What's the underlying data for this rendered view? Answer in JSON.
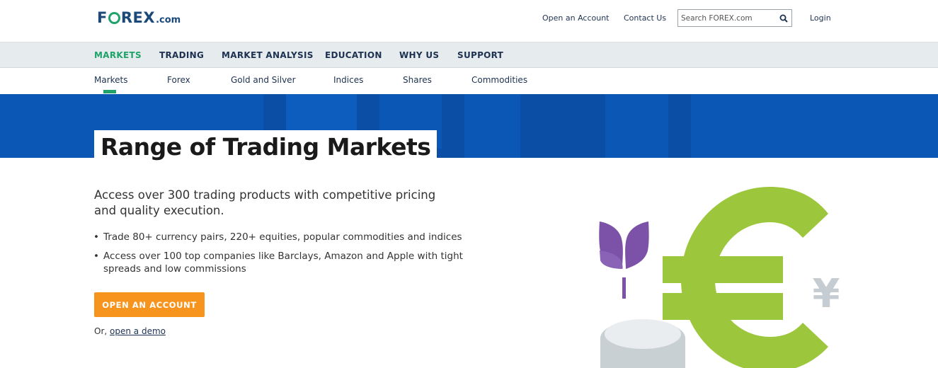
{
  "header": {
    "logo": {
      "left": "F",
      "right": "REX",
      "suffix": ".com"
    },
    "links": {
      "open_account": "Open an Account",
      "contact": "Contact Us",
      "login": "Login"
    },
    "search": {
      "placeholder": "Search FOREX.com"
    }
  },
  "main_nav": [
    {
      "label": "MARKETS",
      "active": true
    },
    {
      "label": "TRADING",
      "active": false
    },
    {
      "label": "MARKET ANALYSIS",
      "active": false
    },
    {
      "label": "EDUCATION",
      "active": false
    },
    {
      "label": "WHY US",
      "active": false
    },
    {
      "label": "SUPPORT",
      "active": false
    }
  ],
  "sub_nav": [
    {
      "label": "Markets",
      "active": true
    },
    {
      "label": "Forex",
      "active": false
    },
    {
      "label": "Gold and Silver",
      "active": false
    },
    {
      "label": "Indices",
      "active": false
    },
    {
      "label": "Shares",
      "active": false
    },
    {
      "label": "Commodities",
      "active": false
    }
  ],
  "hero": {
    "title": "Range of Trading Markets"
  },
  "content": {
    "intro": "Access over 300 trading products with competitive pricing and quality execution.",
    "bullets": [
      "Trade 80+ currency pairs, 220+ equities, popular commodities and indices",
      "Access over 100 top companies like Barclays, Amazon and Apple with tight spreads and low commissions"
    ],
    "cta_label": "OPEN AN ACCOUNT",
    "demo_prefix": "Or, ",
    "demo_link": "open a demo"
  },
  "illustration": {
    "euro_symbol": "€",
    "yen_symbol": "¥"
  },
  "colors": {
    "brand_green": "#1fa36a",
    "brand_navy": "#1d3150",
    "hero_blue": "#0b57b5",
    "cta_orange": "#f7941d",
    "euro_green": "#9cc63b",
    "plant_purple": "#7b52a8",
    "yen_grey": "#c6cdd2"
  },
  "icons": {
    "search": "magnifier-icon",
    "logo_o": "globe-o-icon"
  }
}
